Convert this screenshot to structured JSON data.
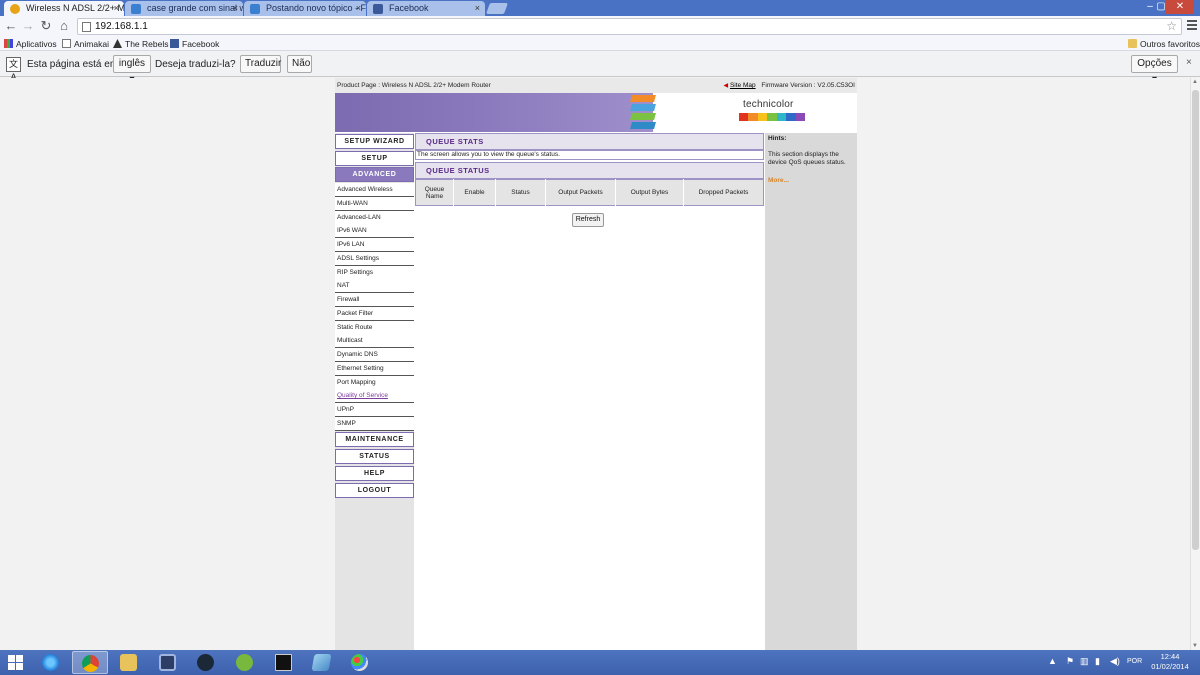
{
  "browser": {
    "tabs": [
      {
        "label": "Wireless N ADSL 2/2+ Mo",
        "active": true
      },
      {
        "label": "case grande com sinal wi"
      },
      {
        "label": "Postando novo tópico - F"
      },
      {
        "label": "Facebook"
      }
    ],
    "close_glyph": "×",
    "url": "192.168.1.1",
    "bookmarks": {
      "apps": "Aplicativos",
      "item1": "Animakai",
      "item2": "The Rebels",
      "item3": "Facebook",
      "others": "Outros favoritos"
    },
    "translate": {
      "prefix": "Esta página está em",
      "language": "inglês ▾",
      "question": "Deseja traduzi-la?",
      "translate_btn": "Traduzir",
      "no_btn": "Não",
      "options_btn": "Opções ▾",
      "close_glyph": "×"
    }
  },
  "router": {
    "product_page": "Product Page : Wireless N ADSL 2/2+ Modem Router",
    "site_map": "Site Map",
    "firmware": "Firmware Version : V2.05.C53OI",
    "logo_text": "technicolor",
    "nav": {
      "setup_wizard": "SETUP WIZARD",
      "setup": "SETUP",
      "advanced": "ADVANCED",
      "advanced_items": [
        "Advanced Wireless",
        "Multi-WAN",
        "Advanced-LAN",
        "IPv6 WAN",
        "IPv6 LAN",
        "ADSL Settings",
        "RIP Settings",
        "NAT",
        "Firewall",
        "Packet Filter",
        "Static Route",
        "Multicast",
        "Dynamic DNS",
        "Ethernet Setting",
        "Port Mapping",
        "Quality of Service",
        "UPnP",
        "SNMP"
      ],
      "maintenance": "MAINTENANCE",
      "status": "STATUS",
      "help": "HELP",
      "logout": "LOGOUT"
    },
    "main": {
      "queue_stats_title": "QUEUE STATS",
      "description": "The screen allows you to view the queue's status.",
      "queue_status_title": "QUEUE STATUS",
      "columns": [
        "Queue Name",
        "Enable",
        "Status",
        "Output Packets",
        "Output Bytes",
        "Dropped Packets"
      ],
      "refresh_btn": "Refresh"
    },
    "hints": {
      "title": "Hints:",
      "text": "This section displays the device QoS queues status.",
      "more": "More..."
    }
  },
  "taskbar": {
    "language": "POR",
    "time": "12:44",
    "date": "01/02/2014"
  }
}
